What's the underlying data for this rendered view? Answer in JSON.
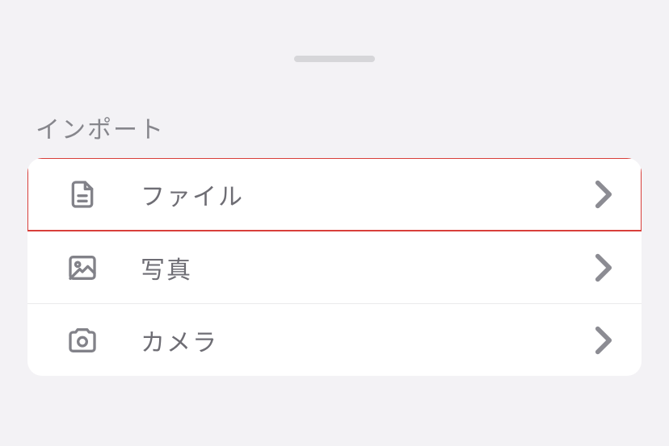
{
  "section_title": "インポート",
  "items": [
    {
      "label": "ファイル",
      "icon": "file-text-icon",
      "highlighted": true
    },
    {
      "label": "写真",
      "icon": "photo-icon",
      "highlighted": false
    },
    {
      "label": "カメラ",
      "icon": "camera-icon",
      "highlighted": false
    }
  ]
}
